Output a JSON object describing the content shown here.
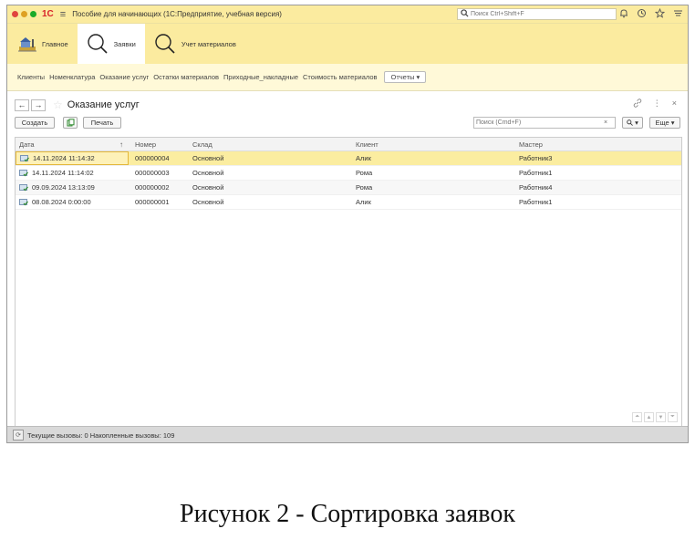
{
  "titlebar": {
    "logo": "1С",
    "app_title": "Пособие для начинающих  (1С:Предприятие, учебная версия)",
    "search_placeholder": "Поиск Ctrl+Shift+F"
  },
  "sections": [
    {
      "label": "Главное",
      "icon": "house-icon"
    },
    {
      "label": "Заявки",
      "icon": "search-icon"
    },
    {
      "label": "Учет материалов",
      "icon": "search-icon"
    }
  ],
  "function_bar": {
    "links": [
      "Клиенты",
      "Номенклатура",
      "Оказание услуг",
      "Остатки материалов",
      "Приходные_накладные",
      "Стоимость материалов"
    ],
    "reports_label": "Отчеты"
  },
  "form": {
    "title": "Оказание услуг",
    "create_label": "Создать",
    "print_label": "Печать",
    "search_placeholder": "Поиск (Cmd+F)",
    "more_label": "Еще"
  },
  "table": {
    "columns": [
      "Дата",
      "Номер",
      "Склад",
      "Клиент",
      "Мастер"
    ],
    "rows": [
      {
        "date": "14.11.2024 11:14:32",
        "number": "000000004",
        "warehouse": "Основной",
        "client": "Алик",
        "master": "Работник3"
      },
      {
        "date": "14.11.2024 11:14:02",
        "number": "000000003",
        "warehouse": "Основной",
        "client": "Рома",
        "master": "Работник1"
      },
      {
        "date": "09.09.2024 13:13:09",
        "number": "000000002",
        "warehouse": "Основной",
        "client": "Рома",
        "master": "Работник4"
      },
      {
        "date": "08.08.2024 0:00:00",
        "number": "000000001",
        "warehouse": "Основной",
        "client": "Алик",
        "master": "Работник1"
      }
    ]
  },
  "status": {
    "text": "Текущие вызовы: 0   Накопленные вызовы: 109"
  },
  "caption": "Рисунок 2 - Сортировка заявок",
  "colors": {
    "header_yellow": "#fbeb9f",
    "selected_row": "#fbeda0",
    "logo_red": "#d8232a"
  }
}
